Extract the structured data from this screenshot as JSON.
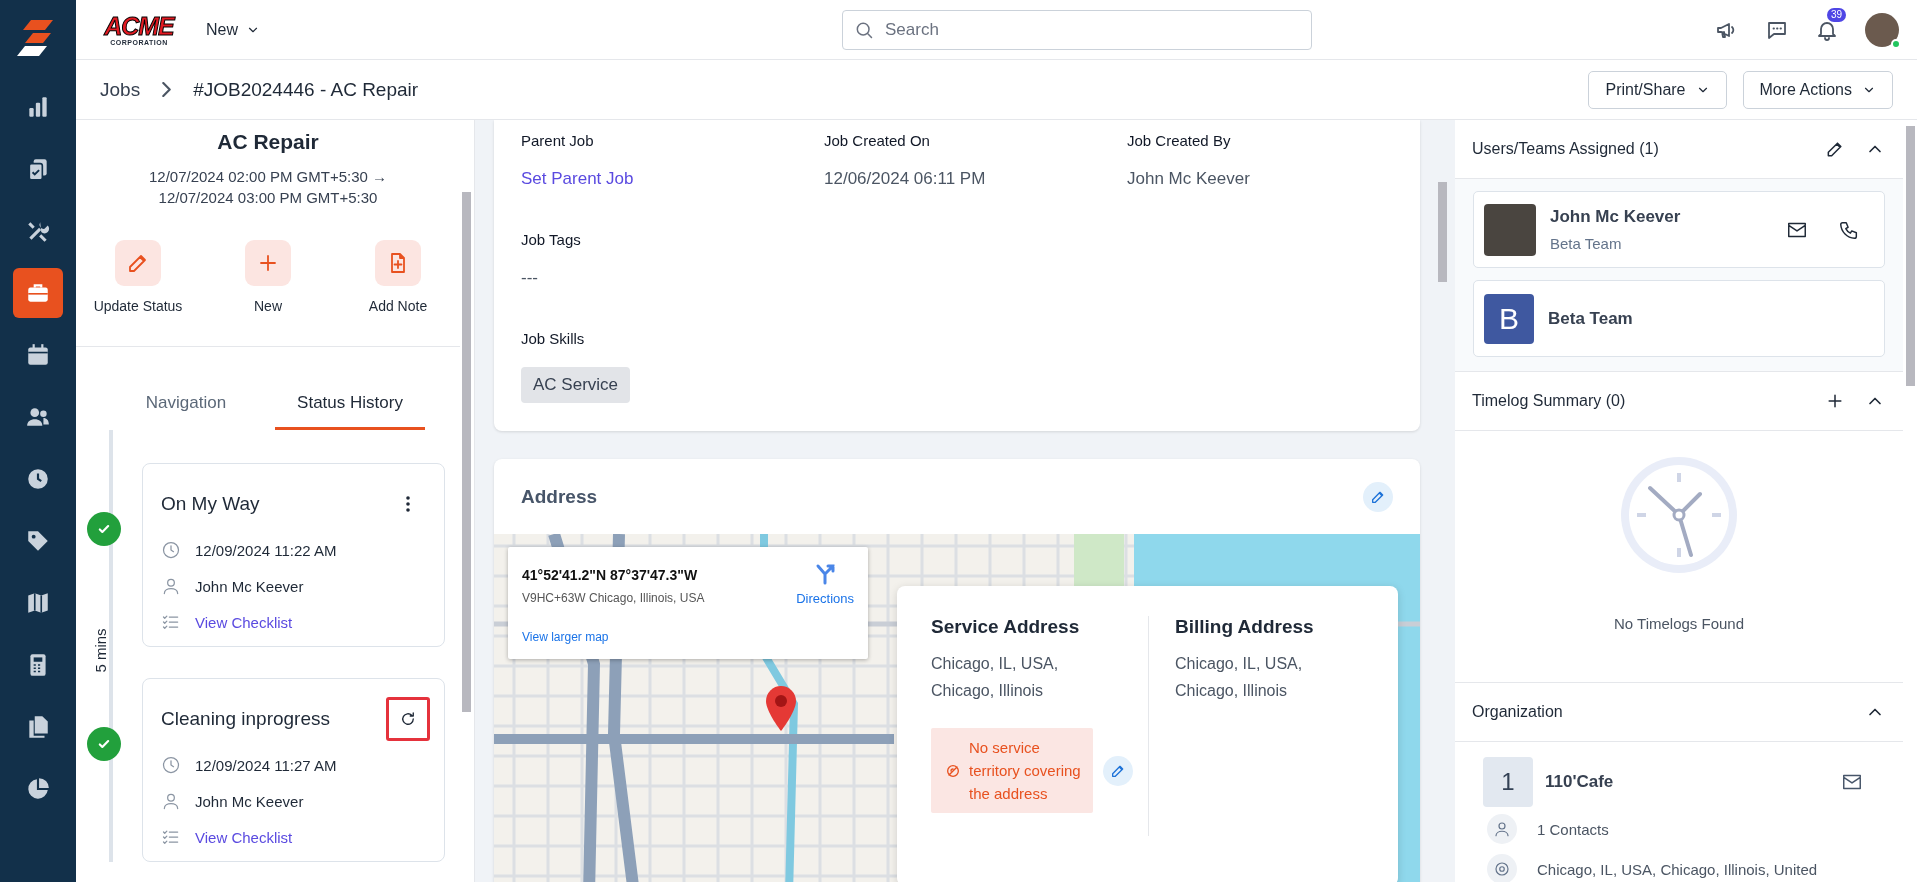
{
  "sidebar": {
    "items": [
      {
        "kind": "chart",
        "selected": false
      },
      {
        "kind": "clipboard",
        "selected": false
      },
      {
        "kind": "tools",
        "selected": false
      },
      {
        "kind": "briefcase",
        "selected": true
      },
      {
        "kind": "calendar",
        "selected": false
      },
      {
        "kind": "people",
        "selected": false
      },
      {
        "kind": "clock",
        "selected": false
      },
      {
        "kind": "tag",
        "selected": false
      },
      {
        "kind": "map",
        "selected": false
      },
      {
        "kind": "calculator",
        "selected": false
      },
      {
        "kind": "files",
        "selected": false
      },
      {
        "kind": "pie",
        "selected": false
      }
    ]
  },
  "header": {
    "logo": {
      "name": "ACME",
      "subtitle": "CORPORATION"
    },
    "new_menu": "New",
    "search": {
      "placeholder": "Search"
    },
    "notification_count": "39"
  },
  "breadcrumb": {
    "items": [
      "Jobs",
      "#JOB2024446 - AC Repair"
    ],
    "buttons": [
      "Print/Share",
      "More Actions"
    ]
  },
  "job": {
    "title": "AC Repair",
    "schedule": [
      "12/07/2024 02:00 PM GMT+5:30 →",
      "12/07/2024 03:00 PM GMT+5:30"
    ],
    "quick_actions": [
      {
        "kind": "edit",
        "label": "Update Status"
      },
      {
        "kind": "add",
        "label": "New"
      },
      {
        "kind": "note",
        "label": "Add Note"
      }
    ],
    "tabs": [
      {
        "label": "Navigation",
        "selected": false
      },
      {
        "label": "Status History",
        "selected": true
      }
    ],
    "status_history": {
      "gap": "5 mins",
      "entries": [
        {
          "title": "On My Way",
          "kind": "menu",
          "highlighted": false,
          "time": "12/09/2024 11:22 AM",
          "user": "John Mc Keever",
          "link": "View Checklist"
        },
        {
          "title": "Cleaning inprogress",
          "kind": "refresh",
          "highlighted": true,
          "time": "12/09/2024 11:27 AM",
          "user": "John Mc Keever",
          "link": "View Checklist"
        }
      ]
    }
  },
  "details": {
    "rows": [
      {
        "fields": [
          {
            "label": "Parent Job",
            "kind": "link",
            "value": "Set Parent Job"
          },
          {
            "label": "Job Created On",
            "kind": "text",
            "value": "12/06/2024 06:11 PM"
          },
          {
            "label": "Job Created By",
            "kind": "text",
            "value": "John Mc Keever"
          }
        ]
      },
      {
        "fields": [
          {
            "label": "Job Tags",
            "kind": "text",
            "value": "---"
          }
        ]
      },
      {
        "fields": [
          {
            "label": "Job Skills",
            "kind": "chip",
            "value": "AC Service"
          }
        ]
      }
    ]
  },
  "address": {
    "title": "Address",
    "map_popup": {
      "coordinates": "41°52'41.2\"N 87°37'47.3\"W",
      "plus_code": "V9HC+63W Chicago, Illinois, USA",
      "directions": "Directions",
      "larger_map": "View larger map"
    },
    "columns": [
      {
        "title": "Service Address",
        "lines": [
          "Chicago, IL, USA,",
          "Chicago, Illinois"
        ]
      },
      {
        "title": "Billing Address",
        "lines": [
          "Chicago, IL, USA,",
          "Chicago, Illinois"
        ]
      }
    ],
    "warning": "No service territory covering the address"
  },
  "right_panel": {
    "assigned": {
      "title": "Users/Teams Assigned (1)",
      "expanded": true,
      "members": [
        {
          "kind": "user",
          "name": "John Mc Keever",
          "team": "Beta Team"
        },
        {
          "kind": "team",
          "initial": "B",
          "name": "Beta Team"
        }
      ]
    },
    "timelog": {
      "title": "Timelog Summary (0)",
      "expanded": true,
      "empty": "No Timelogs Found"
    },
    "organization": {
      "title": "Organization",
      "expanded": true,
      "initial": "1",
      "name": "110'Cafe",
      "contacts": "1 Contacts",
      "address": "Chicago, IL, USA, Chicago, Illinois, United"
    }
  }
}
